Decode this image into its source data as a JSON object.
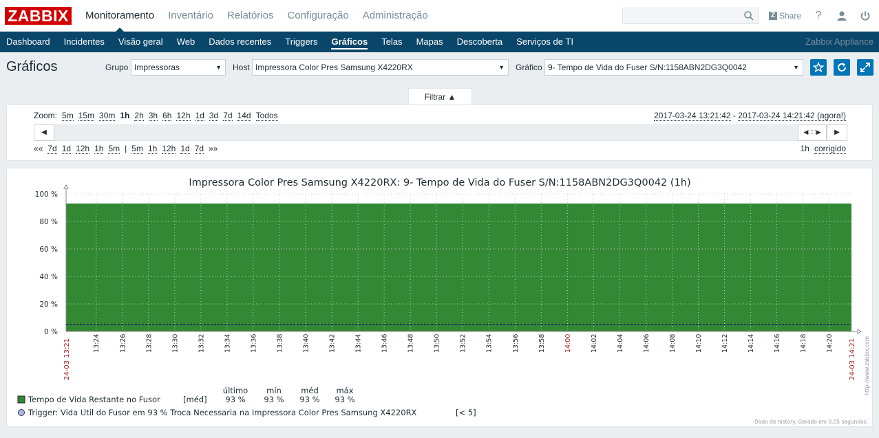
{
  "header": {
    "logo": "ZABBIX",
    "nav": [
      "Monitoramento",
      "Inventário",
      "Relatórios",
      "Configuração",
      "Administração"
    ],
    "selected_nav": 0,
    "search_value": "",
    "share": "Share",
    "help": "?"
  },
  "subnav": {
    "items": [
      "Dashboard",
      "Incidentes",
      "Visão geral",
      "Web",
      "Dados recentes",
      "Triggers",
      "Gráficos",
      "Telas",
      "Mapas",
      "Descoberta",
      "Serviços de TI"
    ],
    "selected": 6,
    "appliance": "Zabbix Appliance"
  },
  "page": {
    "title": "Gráficos",
    "group_label": "Grupo",
    "group_value": "Impressoras",
    "host_label": "Host",
    "host_value": "Impressora Color Pres Samsung X4220RX",
    "graph_label": "Gráfico",
    "graph_value": "9- Tempo de Vida do Fuser S/N:1158ABN2DG3Q0042",
    "filter_tab": "Filtrar ▲"
  },
  "timeline": {
    "zoom_label": "Zoom:",
    "zoom": [
      "5m",
      "15m",
      "30m",
      "1h",
      "2h",
      "3h",
      "6h",
      "12h",
      "1d",
      "3d",
      "7d",
      "14d",
      "Todos"
    ],
    "zoom_selected": 3,
    "from": "2017-03-24 13:21:42",
    "sep": " - ",
    "to": "2017-03-24 14:21:42 (agora!)",
    "nav_left": [
      "««",
      "7d",
      "1d",
      "12h",
      "1h",
      "5m",
      "|",
      "5m",
      "1h",
      "12h",
      "1d",
      "7d",
      "»»"
    ],
    "period": "1h",
    "fixed": "corrigido"
  },
  "graph": {
    "title": "Impressora Color Pres Samsung  X4220RX: 9- Tempo de Vida do Fuser S/N:1158ABN2DG3Q0042 (1h)",
    "color_area": "#338833",
    "trigger_color": "#1f3a5a",
    "watermark": "http://www.zabbix.com",
    "footer": "Dado de history. Gerado em 0.05 segundos.",
    "legend_head": [
      "último",
      "mín",
      "méd",
      "máx"
    ],
    "legend_item": {
      "name": "Tempo de Vida Restante no Fusor",
      "func": "[méd]",
      "values": [
        "93 %",
        "93 %",
        "93 %",
        "93 %"
      ]
    },
    "trigger": {
      "name": "Trigger: Vida Util do Fusor em 93 % Troca Necessaria na Impressora Color Pres Samsung  X4220RX",
      "cond": "[< 5]"
    }
  },
  "chart_data": {
    "type": "area",
    "title": "Impressora Color Pres Samsung  X4220RX: 9- Tempo de Vida do Fuser S/N:1158ABN2DG3Q0042 (1h)",
    "y_ticks": [
      "0 %",
      "20 %",
      "40 %",
      "60 %",
      "80 %",
      "100 %"
    ],
    "ylim": [
      0,
      100
    ],
    "x_ticks": [
      "13:24",
      "13:26",
      "13:28",
      "13:30",
      "13:32",
      "13:34",
      "13:36",
      "13:38",
      "13:40",
      "13:42",
      "13:44",
      "13:46",
      "13:48",
      "13:50",
      "13:52",
      "13:54",
      "13:56",
      "13:58",
      "14:00",
      "14:02",
      "14:04",
      "14:06",
      "14:08",
      "14:10",
      "14:12",
      "14:14",
      "14:16",
      "14:18",
      "14:20"
    ],
    "x_start": "24-03 13:21",
    "x_end": "24-03 14:21",
    "series": [
      {
        "name": "Tempo de Vida Restante no Fusor",
        "values": [
          93,
          93
        ]
      }
    ],
    "trigger_value": 5,
    "grid": true
  }
}
